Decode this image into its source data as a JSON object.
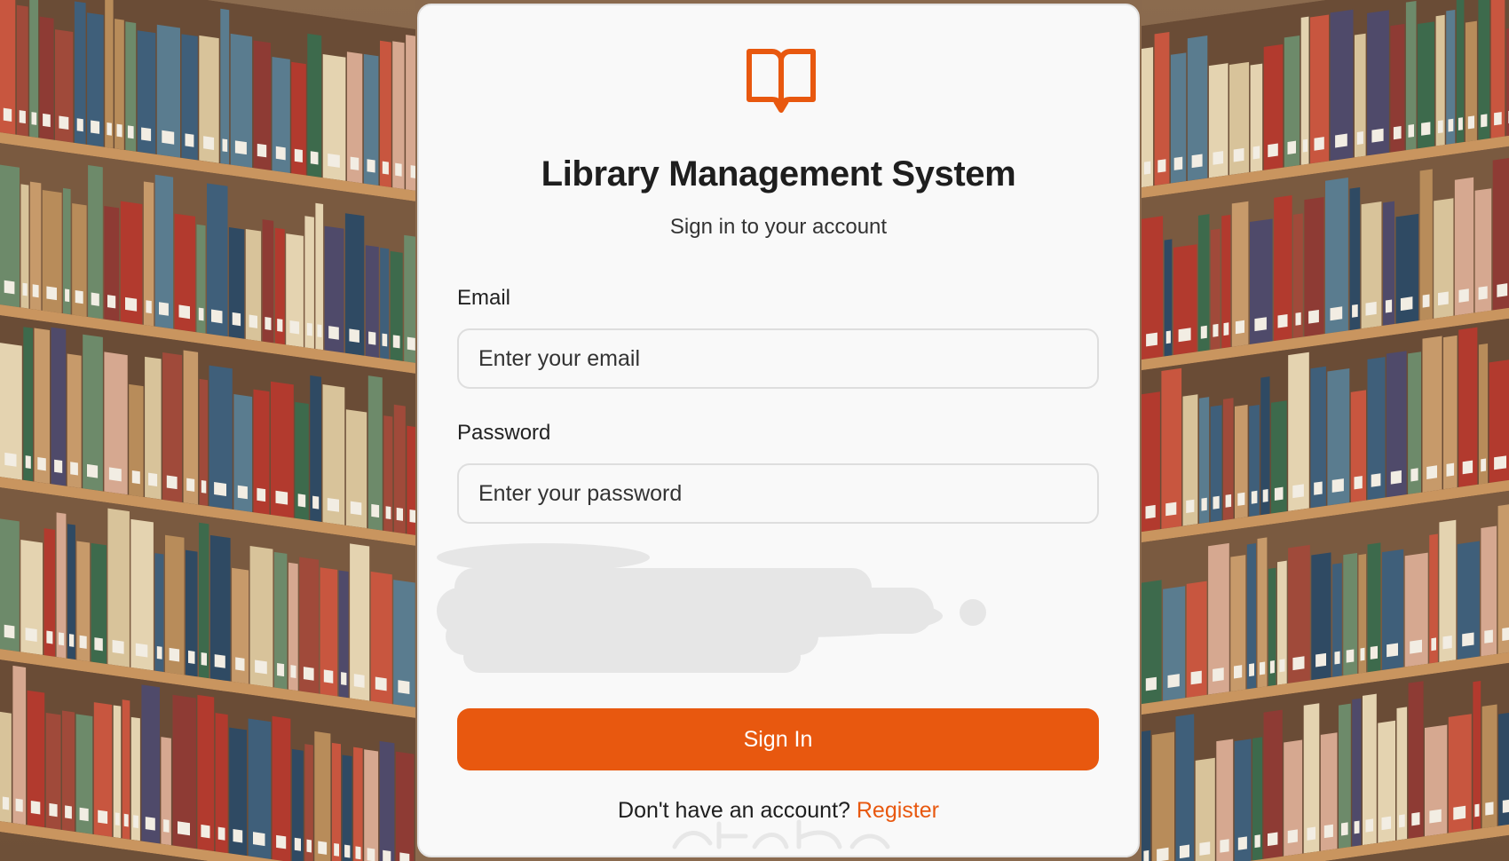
{
  "app": {
    "title": "Library Management System",
    "subtitle": "Sign in to your account"
  },
  "form": {
    "email_label": "Email",
    "email_placeholder": "Enter your email",
    "email_value": "",
    "password_label": "Password",
    "password_placeholder": "Enter your password",
    "password_value": "",
    "submit_label": "Sign In"
  },
  "footer": {
    "prompt": "Don't have an account?",
    "register_label": "Register"
  },
  "icons": {
    "logo": "open-book-icon"
  },
  "colors": {
    "accent": "#e8580f",
    "card_background": "#f9f9f9",
    "input_border": "#dedede",
    "text_primary": "#1e1e1e"
  }
}
